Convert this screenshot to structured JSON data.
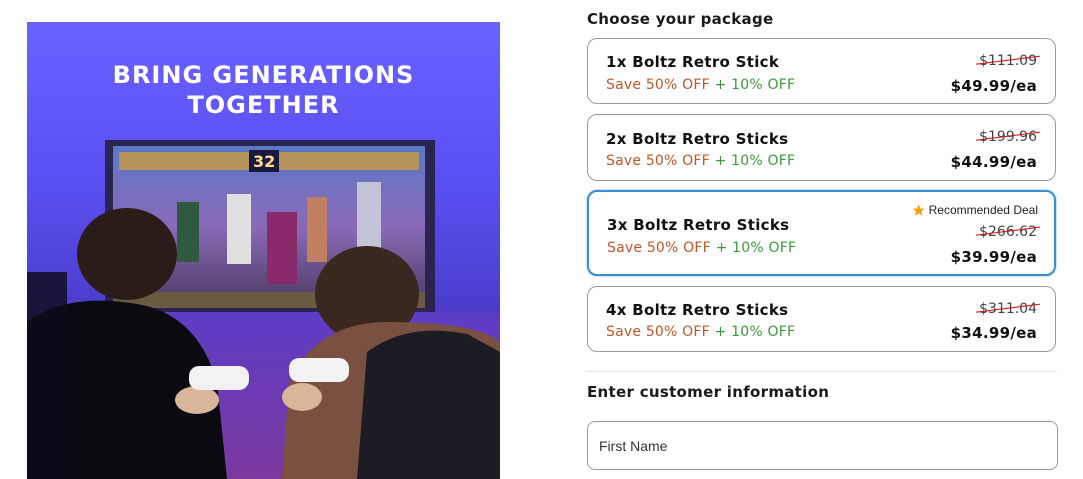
{
  "hero": {
    "headline_line1": "BRING GENERATIONS",
    "headline_line2": "TOGETHER"
  },
  "package_section": {
    "title": "Choose your package",
    "packages": [
      {
        "name": "1x Boltz Retro Stick",
        "save_discount": "Save 50% OFF",
        "extra_discount": "+ 10% OFF",
        "old_price": "$111.09",
        "price": "$49.99/ea",
        "selected": false
      },
      {
        "name": "2x Boltz Retro Sticks",
        "save_discount": "Save 50% OFF",
        "extra_discount": "+ 10% OFF",
        "old_price": "$199.96",
        "price": "$44.99/ea",
        "selected": false
      },
      {
        "name": "3x Boltz Retro Sticks",
        "save_discount": "Save 50% OFF",
        "extra_discount": "+ 10% OFF",
        "old_price": "$266.62",
        "price": "$39.99/ea",
        "selected": true,
        "badge": "Recommended Deal",
        "badge_icon": "star-icon"
      },
      {
        "name": "4x Boltz Retro Sticks",
        "save_discount": "Save 50% OFF",
        "extra_discount": "+ 10% OFF",
        "old_price": "$311.04",
        "price": "$34.99/ea",
        "selected": false
      }
    ]
  },
  "customer_section": {
    "title": "Enter customer information",
    "first_name_placeholder": "First Name"
  },
  "colors": {
    "save_text": "#c0562a",
    "extra_text": "#3c9a3c",
    "strike_line": "#d11f1f",
    "selected_border": "#3a8fd6",
    "badge_star": "#f5a300"
  }
}
